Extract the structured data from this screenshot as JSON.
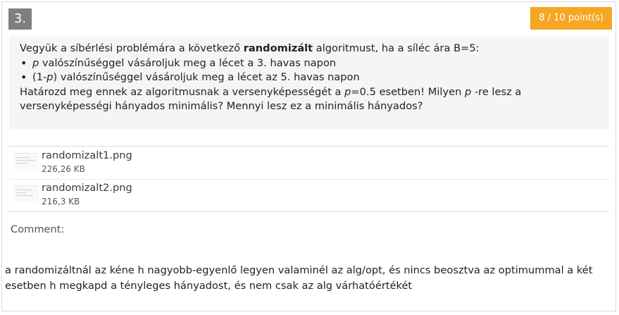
{
  "question": {
    "number": "3.",
    "points": "8 / 10 point(s)",
    "line1_a": "Vegyük a síbérlési problémára a következő ",
    "line1_bold": "randomizált",
    "line1_b": " algoritmust, ha a síléc ára B=5:",
    "bullet1_var": "p",
    "bullet1_text": " valószínűséggel vásároljuk meg a lécet a 3. havas napon",
    "bullet2_a": "(1-",
    "bullet2_var": "p",
    "bullet2_b": ") valószínűséggel vásároljuk meg a lécet az 5. havas napon",
    "line4_a": "Határozd meg ennek az algoritmusnak a versenyképességét a ",
    "line4_var": "p",
    "line4_b": "=0.5 esetben! Milyen ",
    "line4_var2": "p",
    "line4_c": " -re lesz a",
    "line5": "versenyképességi hányados minimális? Mennyi lesz ez a minimális hányados?"
  },
  "attachments": [
    {
      "name": "randomizalt1.png",
      "size": "226,26 KB",
      "icon": "image-thumbnail"
    },
    {
      "name": "randomizalt2.png",
      "size": "216,3 KB",
      "icon": "image-thumbnail"
    }
  ],
  "comment": {
    "label": "Comment:",
    "text": "a randomizáltnál az kéne h nagyobb-egyenlő legyen valaminél az alg/opt, és nincs beosztva az optimummal a két esetben h megkapd a tényleges hányadost, és nem csak az alg várhatóértékét"
  },
  "colors": {
    "points_badge": "#f6a623",
    "number_badge": "#7f7f7f",
    "prompt_bg": "#f5f5f5"
  }
}
